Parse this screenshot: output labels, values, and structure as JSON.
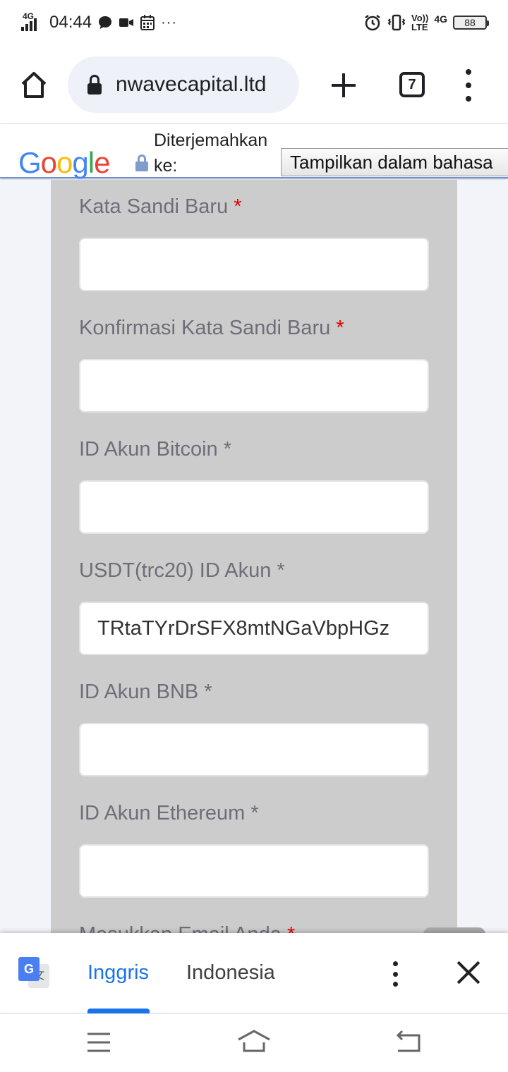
{
  "status_bar": {
    "network": "4G",
    "time": "04:44",
    "overflow": "···",
    "volte_top": "Vo))",
    "volte_bottom": "LTE",
    "net_right": "4G",
    "battery": "88"
  },
  "toolbar": {
    "url": "nwavecapital.ltd",
    "tab_count": "7"
  },
  "google_translate_bar": {
    "translated_label_line1": "Diterjemahkan",
    "translated_label_line2": "ke:",
    "show_original_button": "Tampilkan dalam bahasa"
  },
  "form": {
    "fields": [
      {
        "label": "Kata Sandi Baru",
        "required_mark": "*",
        "required_red": true,
        "value": ""
      },
      {
        "label": "Konfirmasi Kata Sandi Baru",
        "required_mark": "*",
        "required_red": true,
        "value": ""
      },
      {
        "label": "ID Akun Bitcoin",
        "required_mark": "*",
        "required_red": false,
        "value": ""
      },
      {
        "label": "USDT(trc20) ID Akun",
        "required_mark": "*",
        "required_red": false,
        "value": "TRtaTYrDrSFX8mtNGaVbpHGz"
      },
      {
        "label": "ID Akun BNB",
        "required_mark": "*",
        "required_red": false,
        "value": ""
      },
      {
        "label": "ID Akun Ethereum",
        "required_mark": "*",
        "required_red": false,
        "value": ""
      },
      {
        "label": "Masukkan Email Anda",
        "required_mark": "*",
        "required_red": true,
        "value": ""
      }
    ]
  },
  "translate_bottom_bar": {
    "source_lang": "Inggris",
    "target_lang": "Indonesia"
  },
  "colors": {
    "accent": "#1a73e8",
    "required": "#e10000",
    "card": "#cccccc",
    "page_bg": "#f2f4f9"
  }
}
